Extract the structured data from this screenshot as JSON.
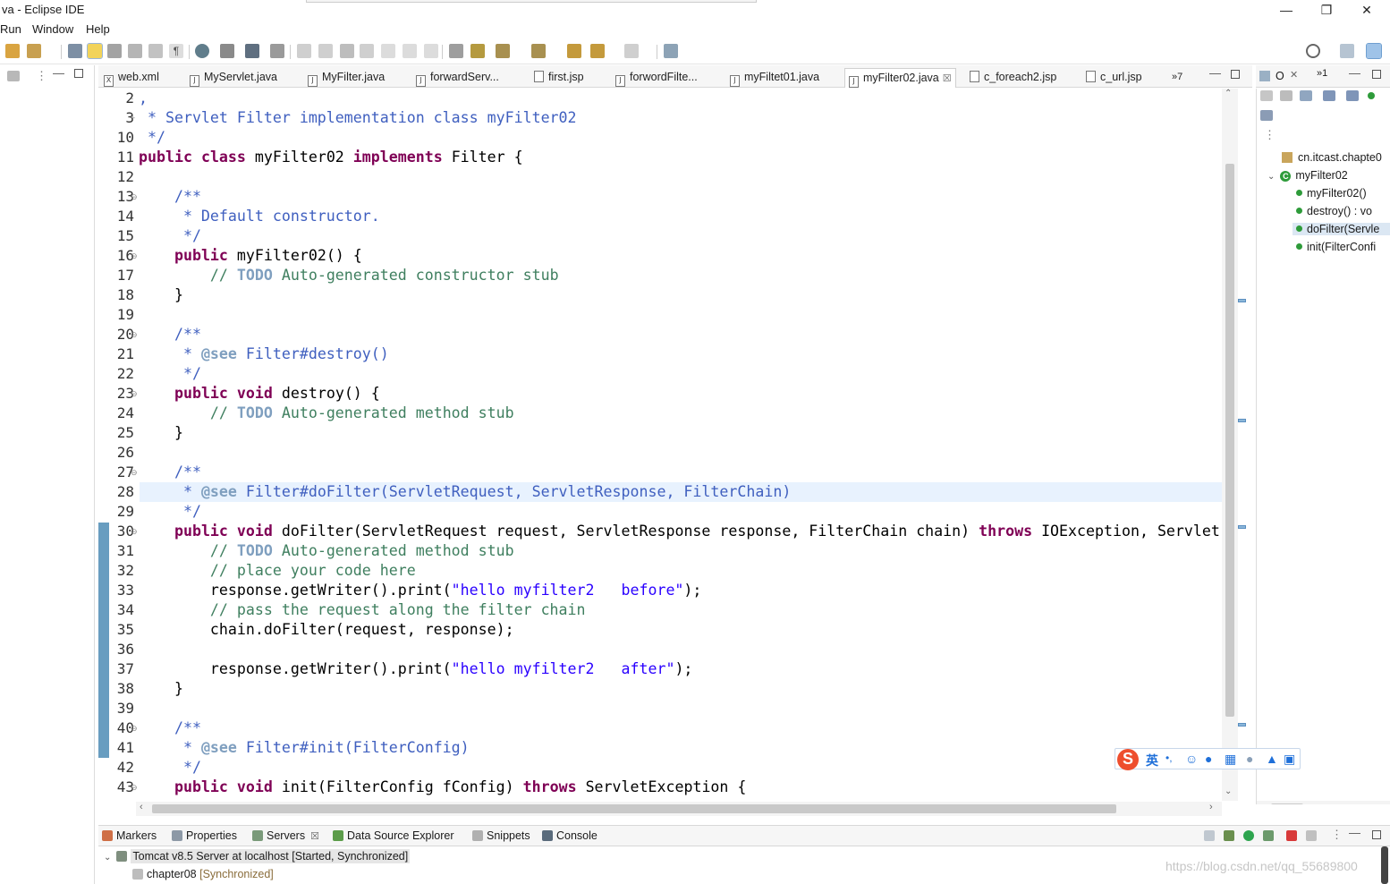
{
  "window": {
    "title": "va - Eclipse IDE",
    "controls": [
      "—",
      "❐",
      "✕"
    ]
  },
  "menu": [
    "Run",
    "Window",
    "Help"
  ],
  "editor_tabs": [
    {
      "label": "web.xml",
      "icon": "X"
    },
    {
      "label": "MyServlet.java",
      "icon": "J"
    },
    {
      "label": "MyFilter.java",
      "icon": "J"
    },
    {
      "label": "forwardServ...",
      "icon": "J"
    },
    {
      "label": "first.jsp",
      "icon": ""
    },
    {
      "label": "forwordFilte...",
      "icon": "J"
    },
    {
      "label": "myFiltet01.java",
      "icon": "J"
    },
    {
      "label": "myFilter02.java",
      "icon": "J",
      "active": true
    },
    {
      "label": "c_foreach2.jsp",
      "icon": ""
    },
    {
      "label": "c_url.jsp",
      "icon": ""
    }
  ],
  "tabs_overflow": "»7",
  "editor": {
    "lines": [
      {
        "n": "2",
        "fold": "-",
        "code": ","
      },
      {
        "n": "3",
        "fold": "+",
        "code": " * Servlet Filter implementation class myFilter02"
      },
      {
        "n": "10",
        "fold": "",
        "code": " */"
      },
      {
        "n": "11",
        "fold": "",
        "code": "public class myFilter02 implements Filter {"
      },
      {
        "n": "12",
        "fold": "",
        "code": ""
      },
      {
        "n": "13",
        "fold": "⊖",
        "code": "    /**"
      },
      {
        "n": "14",
        "fold": "",
        "code": "     * Default constructor."
      },
      {
        "n": "15",
        "fold": "",
        "code": "     */"
      },
      {
        "n": "16",
        "fold": "⊖",
        "code": "    public myFilter02() {"
      },
      {
        "n": "17",
        "fold": "",
        "code": "        // TODO Auto-generated constructor stub"
      },
      {
        "n": "18",
        "fold": "",
        "code": "    }"
      },
      {
        "n": "19",
        "fold": "",
        "code": ""
      },
      {
        "n": "20",
        "fold": "⊖",
        "code": "    /**"
      },
      {
        "n": "21",
        "fold": "",
        "code": "     * @see Filter#destroy()"
      },
      {
        "n": "22",
        "fold": "",
        "code": "     */"
      },
      {
        "n": "23",
        "fold": "⊖",
        "code": "    public void destroy() {"
      },
      {
        "n": "24",
        "fold": "",
        "code": "        // TODO Auto-generated method stub"
      },
      {
        "n": "25",
        "fold": "",
        "code": "    }"
      },
      {
        "n": "26",
        "fold": "",
        "code": ""
      },
      {
        "n": "27",
        "fold": "⊖",
        "code": "    /**"
      },
      {
        "n": "28",
        "fold": "",
        "code": "     * @see Filter#doFilter(ServletRequest, ServletResponse, FilterChain)"
      },
      {
        "n": "29",
        "fold": "",
        "code": "     */"
      },
      {
        "n": "30",
        "fold": "⊖",
        "code": "    public void doFilter(ServletRequest request, ServletResponse response, FilterChain chain) throws IOException, Servlet"
      },
      {
        "n": "31",
        "fold": "",
        "code": "        // TODO Auto-generated method stub"
      },
      {
        "n": "32",
        "fold": "",
        "code": "        // place your code here"
      },
      {
        "n": "33",
        "fold": "",
        "code": "        response.getWriter().print(\"hello myfilter2   before\");"
      },
      {
        "n": "34",
        "fold": "",
        "code": "        // pass the request along the filter chain"
      },
      {
        "n": "35",
        "fold": "",
        "code": "        chain.doFilter(request, response);"
      },
      {
        "n": "36",
        "fold": "",
        "code": ""
      },
      {
        "n": "37",
        "fold": "",
        "code": "        response.getWriter().print(\"hello myfilter2   after\");"
      },
      {
        "n": "38",
        "fold": "",
        "code": "    }"
      },
      {
        "n": "39",
        "fold": "",
        "code": ""
      },
      {
        "n": "40",
        "fold": "⊖",
        "code": "    /**"
      },
      {
        "n": "41",
        "fold": "",
        "code": "     * @see Filter#init(FilterConfig)"
      },
      {
        "n": "42",
        "fold": "",
        "code": "     */"
      },
      {
        "n": "43",
        "fold": "⊖",
        "code": "    public void init(FilterConfig fConfig) throws ServletException {"
      }
    ],
    "highlighted_line": "28"
  },
  "outline": {
    "header_label": "O",
    "items": [
      {
        "label": "cn.itcast.chapte0",
        "kind": "package"
      },
      {
        "label": "myFilter02",
        "kind": "class"
      },
      {
        "label": "myFilter02()",
        "kind": "constructor"
      },
      {
        "label": "destroy() : vo",
        "kind": "method"
      },
      {
        "label": "doFilter(Servle",
        "kind": "method",
        "selected": true
      },
      {
        "label": "init(FilterConfi",
        "kind": "method"
      }
    ]
  },
  "bottom_tabs": [
    "Markers",
    "Properties",
    "Servers",
    "Data Source Explorer",
    "Snippets",
    "Console"
  ],
  "servers": {
    "server_name": "Tomcat v8.5 Server at localhost",
    "server_state": "[Started, Synchronized]",
    "module_name": "chapter08",
    "module_state": "[Synchronized]"
  },
  "ime": {
    "lang": "英",
    "punct": "•,"
  },
  "watermark": "https://blog.csdn.net/qq_55689800",
  "colors": {
    "keyword": "#7f0055",
    "comment": "#3f5fbf",
    "line_comment": "#3f7f5f",
    "string": "#2a00ff",
    "highlight": "#e8f2fe",
    "gutter_bar": "#4e8cb5"
  }
}
